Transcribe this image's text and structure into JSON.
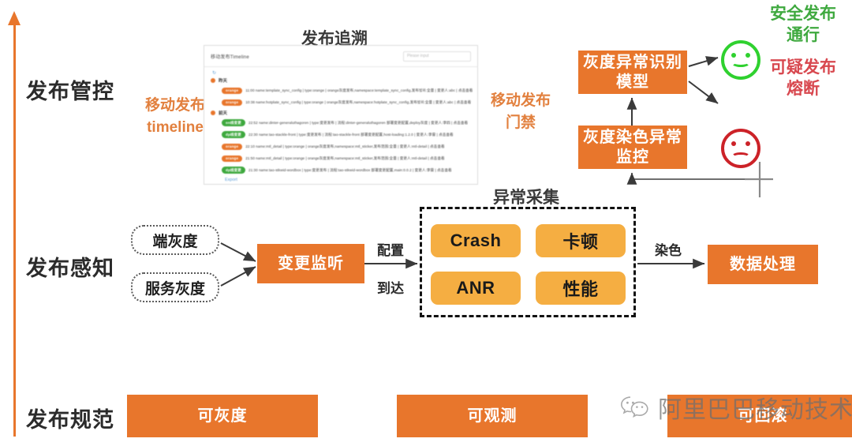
{
  "diagram": {
    "title": "发布追溯",
    "rows": [
      {
        "label": "发布管控"
      },
      {
        "label": "发布感知"
      },
      {
        "label": "发布规范"
      }
    ]
  },
  "annotations": {
    "mobile_release_timeline_l1": "移动发布",
    "mobile_release_timeline_l2": "timeline",
    "mobile_release_gate_l1": "移动发布",
    "mobile_release_gate_l2": "门禁",
    "safe_release_l1": "安全发布",
    "safe_release_l2": "通行",
    "suspicious_release_l1": "可疑发布",
    "suspicious_release_l2": "熔断",
    "exception_collect": "异常采集"
  },
  "edge_labels": {
    "config": "配置",
    "arrive": "到达",
    "dye": "染色"
  },
  "boxes": {
    "gray_anomaly_model_l1": "灰度异常识别",
    "gray_anomaly_model_l2": "模型",
    "gray_dye_monitor_l1": "灰度染色异常",
    "gray_dye_monitor_l2": "监控",
    "change_listen": "变更监听",
    "data_process": "数据处理",
    "can_gray": "可灰度",
    "can_observe": "可观测",
    "can_rollback": "可回滚"
  },
  "capsules": {
    "client_gray": "端灰度",
    "service_gray": "服务灰度"
  },
  "pills": [
    {
      "label": "Crash"
    },
    {
      "label": "卡顿"
    },
    {
      "label": "ANR"
    },
    {
      "label": "性能"
    }
  ],
  "inset": {
    "title": "移动发布Timeline",
    "search_placeholder": "Please input",
    "refresh_icon": "refresh-icon",
    "export_label": "Export",
    "groups": [
      {
        "header": "昨天",
        "rows": [
          {
            "tag": "orange",
            "tag_label": "orange",
            "text": "11:00 name:template_sync_config | type:orange | orange灰度发布,namespace:template_sync_config,发布범위:全量 | 变更人:abc | 点击查看"
          },
          {
            "tag": "orange",
            "tag_label": "orange",
            "text": "10:38 name:hotplate_sync_config | type:orange | orange灰度发布,namespace:hotplate_sync_config,发布범위:全量 | 变更人:abc | 点击查看"
          }
        ]
      },
      {
        "header": "前天",
        "rows": [
          {
            "tag": "green",
            "tag_label": "on线变更",
            "text": "22:52 name:dinter-generaluthagoren | type:变更发布 | 流程:dinter-generaluthagoren 部署变更配置,deploy灰度 | 变更人:李四 | 点击查看"
          },
          {
            "tag": "green",
            "tag_label": "dp线变更",
            "text": "22:30 name:tao-stackle-front | type:变更发布 | 流程:tao-stackle-front 部署变更配置,host-loading:1.2.0 | 变更人:李雷 | 点击查看"
          },
          {
            "tag": "orange",
            "tag_label": "orange",
            "text": "22:10 name:mtl_detail | type:orange | orange灰度发布,namespace:mtl_sticker,发布范围:全量 | 变更人:mtl-detail | 点击查看"
          },
          {
            "tag": "orange",
            "tag_label": "orange",
            "text": "21:50 name:mtl_detail | type:orange | orange灰度发布,namespace:mtl_sticker,发布范围:全量 | 变更人:mtl-detail | 点击查看"
          },
          {
            "tag": "green",
            "tag_label": "dp线变更",
            "text": "21:30 name:tao-stkwid-wordbox | type:变更发布 | 流程:tao-stkwid-wordbox 部署变更配置,main:0.0.2 | 变更人:李雷 | 点击查看"
          }
        ]
      }
    ]
  },
  "watermark": {
    "icon": "wechat-icon",
    "text": "阿里巴巴移动技术"
  },
  "colors": {
    "orange_solid": "#E8762C",
    "yellow_pill": "#F5AE42",
    "green_accent": "#3FA93F",
    "red_accent": "#D8484F",
    "smiley_green": "#2FD12F",
    "smiley_red": "#CC2228",
    "arrow_gray": "#4a4a4a"
  }
}
